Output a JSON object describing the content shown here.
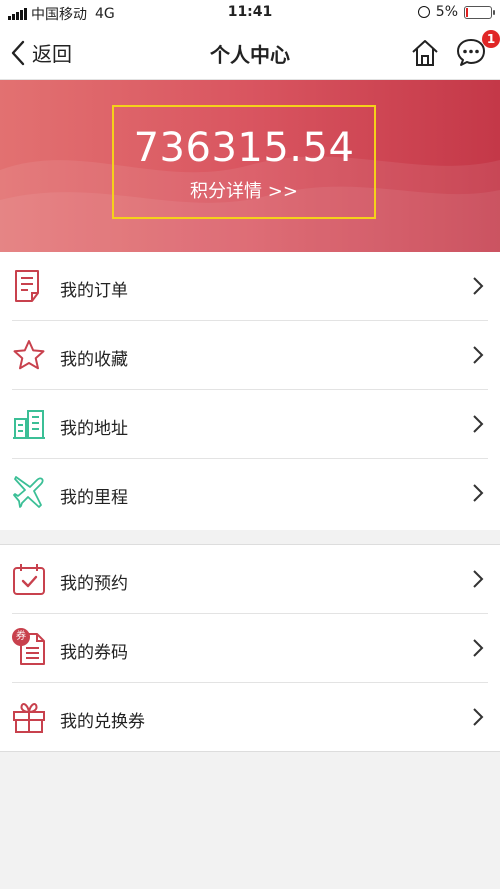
{
  "status_bar": {
    "carrier": "中国移动",
    "network": "4G",
    "time": "11:41",
    "battery_percent": "5%",
    "battery_level": 0.05
  },
  "nav": {
    "back_label": "返回",
    "title": "个人中心",
    "message_badge": "1"
  },
  "banner": {
    "points_value": "736315.54",
    "points_link": "积分详情 >>"
  },
  "menu_group_1": [
    {
      "label": "我的订单",
      "icon": "order-icon"
    },
    {
      "label": "我的收藏",
      "icon": "star-icon"
    },
    {
      "label": "我的地址",
      "icon": "building-icon"
    },
    {
      "label": "我的里程",
      "icon": "plane-icon"
    }
  ],
  "menu_group_2": [
    {
      "label": "我的预约",
      "icon": "calendar-check-icon"
    },
    {
      "label": "我的券码",
      "icon": "coupon-doc-icon",
      "tag": "券"
    },
    {
      "label": "我的兑换券",
      "icon": "gift-icon"
    }
  ],
  "colors": {
    "accent_red": "#c8414d",
    "icon_green": "#3bbf96",
    "banner_start": "#e27171",
    "banner_end": "#c43848",
    "highlight_border": "#f5d11a"
  }
}
